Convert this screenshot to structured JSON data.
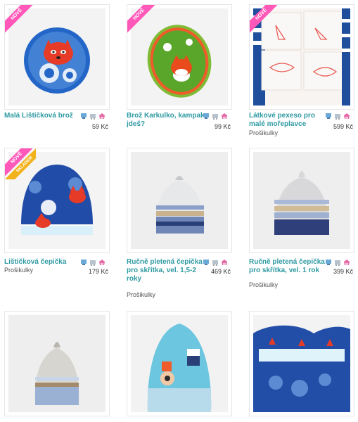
{
  "products": [
    {
      "title": "Malá Lištičková brož",
      "price": "59 Kč",
      "brand": "",
      "badge": "NOVĚ",
      "badge2": ""
    },
    {
      "title": "Brož Karkulko, kampak jdeš?",
      "price": "99 Kč",
      "brand": "",
      "badge": "NOVĚ",
      "badge2": ""
    },
    {
      "title": "Látkové pexeso pro malé mořeplavce",
      "price": "599 Kč",
      "brand": "Prošikulky",
      "badge": "NOVĚ",
      "badge2": ""
    },
    {
      "title": "Lištičková čepička",
      "price": "179 Kč",
      "brand": "Prošikulky",
      "badge": "NOVĚ",
      "badge2": "SKLADEM"
    },
    {
      "title": "Ručně pletená čepička pro skřítka, vel. 1,5-2 roky",
      "price": "469 Kč",
      "brand": "Prošikulky",
      "badge": "",
      "badge2": ""
    },
    {
      "title": "Ručně pletená čepička pro skřítka, vel. 1 rok",
      "price": "399 Kč",
      "brand": "Prošikulky",
      "badge": "",
      "badge2": ""
    },
    {
      "title": "",
      "price": "",
      "brand": "",
      "badge": "",
      "badge2": ""
    },
    {
      "title": "",
      "price": "",
      "brand": "",
      "badge": "",
      "badge2": ""
    },
    {
      "title": "",
      "price": "",
      "brand": "",
      "badge": "",
      "badge2": ""
    }
  ],
  "icon_names": [
    "compare-icon",
    "cart-icon",
    "wishlist-icon"
  ],
  "colors": {
    "title": "#2f9aa2",
    "badge": "#ff58b8",
    "badge_stock": "#f2b21b"
  }
}
